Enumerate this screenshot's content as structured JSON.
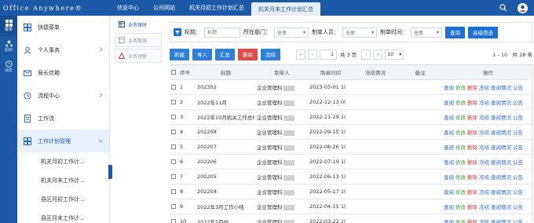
{
  "app": {
    "brand": "Office Anywhere®"
  },
  "tabs": [
    {
      "label": "信息中心",
      "active": false
    },
    {
      "label": "公司网站",
      "active": false
    },
    {
      "label": "机关月初工作计划汇总",
      "active": false
    },
    {
      "label": "机关月末工作计划汇总",
      "active": true
    }
  ],
  "rail": [
    {
      "label": "菜单",
      "icon": "grid-icon"
    },
    {
      "label": "组织",
      "icon": "org-icon"
    },
    {
      "label": "消息",
      "icon": "message-icon"
    }
  ],
  "sidebar": {
    "items": [
      {
        "label": "快捷菜单",
        "icon": "shortcut-icon",
        "expandable": false
      },
      {
        "label": "个人事务",
        "icon": "user-icon",
        "expandable": true
      },
      {
        "label": "局长信箱",
        "icon": "mailbox-icon",
        "expandable": false
      },
      {
        "label": "流程中心",
        "icon": "flow-icon",
        "expandable": true
      },
      {
        "label": "工作流",
        "icon": "document-icon",
        "expandable": false
      },
      {
        "label": "工作计划管理",
        "icon": "plan-icon",
        "expandable": true
      }
    ],
    "subitems": [
      "机关月初工作计...",
      "机关月末工作计...",
      "县区月初工作计...",
      "县区月末工作计..."
    ]
  },
  "subtabs": [
    {
      "label": "业务保时",
      "active": true
    },
    {
      "label": "业务数据",
      "active": false
    },
    {
      "label": "业务预警",
      "active": false
    }
  ],
  "filter": {
    "title_label": "标题：",
    "title_placeholder": "标题",
    "dept_label": "所在部门：",
    "dept_value": "全体",
    "maker_label": "制单人员：",
    "maker_value": "全体",
    "time_label": "制单时间：",
    "time_value": "任意",
    "query_button": "查询",
    "advanced_button": "高级筛选"
  },
  "toolbar": {
    "new": "新建",
    "import": "导入",
    "summary": "汇总",
    "delete": "删除",
    "freeze": "冻结",
    "page_current": "1",
    "page_total": "共 3 页",
    "page_size": "10",
    "range_info": "1 - 10　共 28 条"
  },
  "table": {
    "headers": [
      "序号",
      "标题",
      "制单人",
      "制单时间",
      "冻结情况",
      "备注",
      "操作"
    ],
    "rows": [
      {
        "no": "1",
        "title": "202302",
        "maker": "企业管理科",
        "time": "2023-03-01 1("
      },
      {
        "no": "2",
        "title": "2022年11月",
        "maker": "企业管理科",
        "time": "2022-12-13 0("
      },
      {
        "no": "3",
        "title": "2022年10月机关工作总结",
        "maker": "企业管理科",
        "time": "2022-11-29 1("
      },
      {
        "no": "4",
        "title": "202208",
        "maker": "企业管理科",
        "time": "2022-09-15 1("
      },
      {
        "no": "5",
        "title": "202207",
        "maker": "企业管理科",
        "time": "2022-08-26 1("
      },
      {
        "no": "6",
        "title": "202206",
        "maker": "企业管理科",
        "time": "2022-07-19 1("
      },
      {
        "no": "7",
        "title": "200205",
        "maker": "企业管理科",
        "time": "2022-06-13 1("
      },
      {
        "no": "8",
        "title": "202204",
        "maker": "企业管理科",
        "time": "2022-05-17 1("
      },
      {
        "no": "9",
        "title": "2022年3月工作小结",
        "maker": "企业管理科",
        "time": "2022-04-15 1("
      },
      {
        "no": "10",
        "title": "2022年2月份",
        "maker": "企业管理科",
        "time": "2022-03-22 1("
      }
    ],
    "ops": [
      "查阅",
      "修改",
      "删除",
      "冻结",
      "查阅情况",
      "公告"
    ]
  },
  "colors": {
    "brand": "#1c5aa7",
    "accent": "#1c6fd6",
    "delete": "#e24a4a"
  }
}
